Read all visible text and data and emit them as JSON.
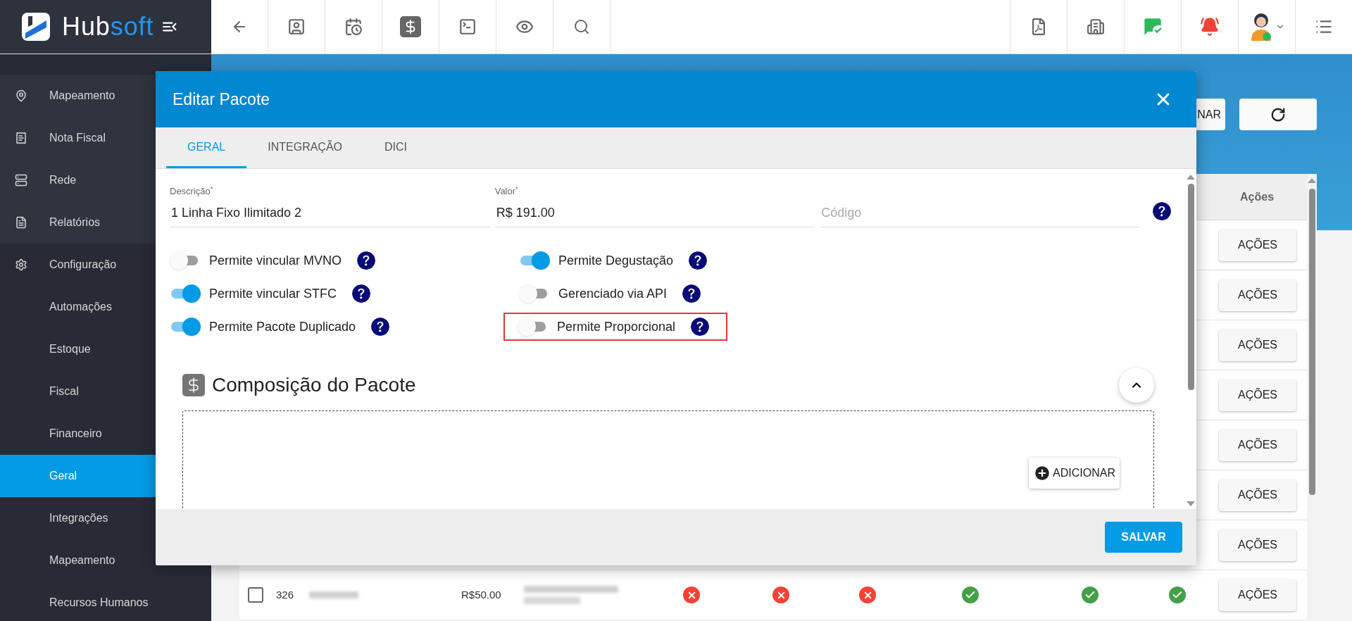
{
  "logo": {
    "main": "Hub",
    "accent": "soft"
  },
  "sidebar": {
    "items": [
      {
        "label": "Mapeamento",
        "kind": "main",
        "selected": false
      },
      {
        "label": "Nota Fiscal",
        "kind": "main",
        "selected": false
      },
      {
        "label": "Rede",
        "kind": "main",
        "selected": false
      },
      {
        "label": "Relatórios",
        "kind": "main",
        "selected": false
      },
      {
        "label": "Configuração",
        "kind": "group",
        "selected": false
      },
      {
        "label": "Automações",
        "kind": "sub",
        "selected": false
      },
      {
        "label": "Estoque",
        "kind": "sub",
        "selected": false
      },
      {
        "label": "Fiscal",
        "kind": "sub",
        "selected": false
      },
      {
        "label": "Financeiro",
        "kind": "sub",
        "selected": false
      },
      {
        "label": "Geral",
        "kind": "sub",
        "selected": true
      },
      {
        "label": "Integrações",
        "kind": "sub",
        "selected": false
      },
      {
        "label": "Mapeamento",
        "kind": "sub",
        "selected": false
      },
      {
        "label": "Recursos Humanos",
        "kind": "sub",
        "selected": false
      }
    ]
  },
  "page": {
    "partial_button": "NAR"
  },
  "table": {
    "header": "Ações",
    "rows": [
      {
        "kind": "covered",
        "action": "AÇÕES"
      },
      {
        "kind": "covered",
        "action": "AÇÕES"
      },
      {
        "kind": "covered",
        "action": "AÇÕES"
      },
      {
        "kind": "covered",
        "action": "AÇÕES"
      },
      {
        "kind": "covered",
        "action": "AÇÕES"
      },
      {
        "kind": "covered",
        "action": "AÇÕES"
      },
      {
        "kind": "covered",
        "action": "AÇÕES"
      },
      {
        "kind": "full",
        "checked": false,
        "number": "326",
        "price": "R$50.00",
        "statuses": [
          {
            "ok": false
          },
          {
            "ok": false
          },
          {
            "ok": false
          },
          {
            "ok": true
          },
          {
            "ok": true
          },
          {
            "ok": true
          }
        ],
        "action": "AÇÕES"
      }
    ]
  },
  "modal": {
    "title": "Editar Pacote",
    "tabs": [
      {
        "label": "GERAL",
        "selected": true
      },
      {
        "label": "INTEGRAÇÃO",
        "selected": false
      },
      {
        "label": "DICI",
        "selected": false
      }
    ],
    "fields": [
      {
        "label": "Descrição$^{*}$",
        "value": "1 Linha Fixo Ilimitado 2"
      },
      {
        "label": "Valor$^{*}$",
        "value": "R$ 191.00"
      },
      {
        "placeholder": "Código"
      }
    ],
    "toggle_columns": [
      [
        {
          "label": "Permite vincular MVNO",
          "on": false,
          "highlighted": false
        },
        {
          "label": "Permite vincular STFC",
          "on": true,
          "highlighted": false
        },
        {
          "label": "Permite Pacote Duplicado",
          "on": true,
          "highlighted": false
        }
      ],
      [
        {
          "label": "Permite Degustação",
          "on": true,
          "highlighted": false
        },
        {
          "label": "Gerenciado via API",
          "on": false,
          "highlighted": false
        },
        {
          "label": "Permite Proporcional",
          "on": false,
          "highlighted": true
        }
      ]
    ],
    "section": {
      "title": "Composição do Pacote",
      "expanded": true,
      "add_button": "ADICIONAR"
    },
    "save_button": "SALVAR"
  }
}
